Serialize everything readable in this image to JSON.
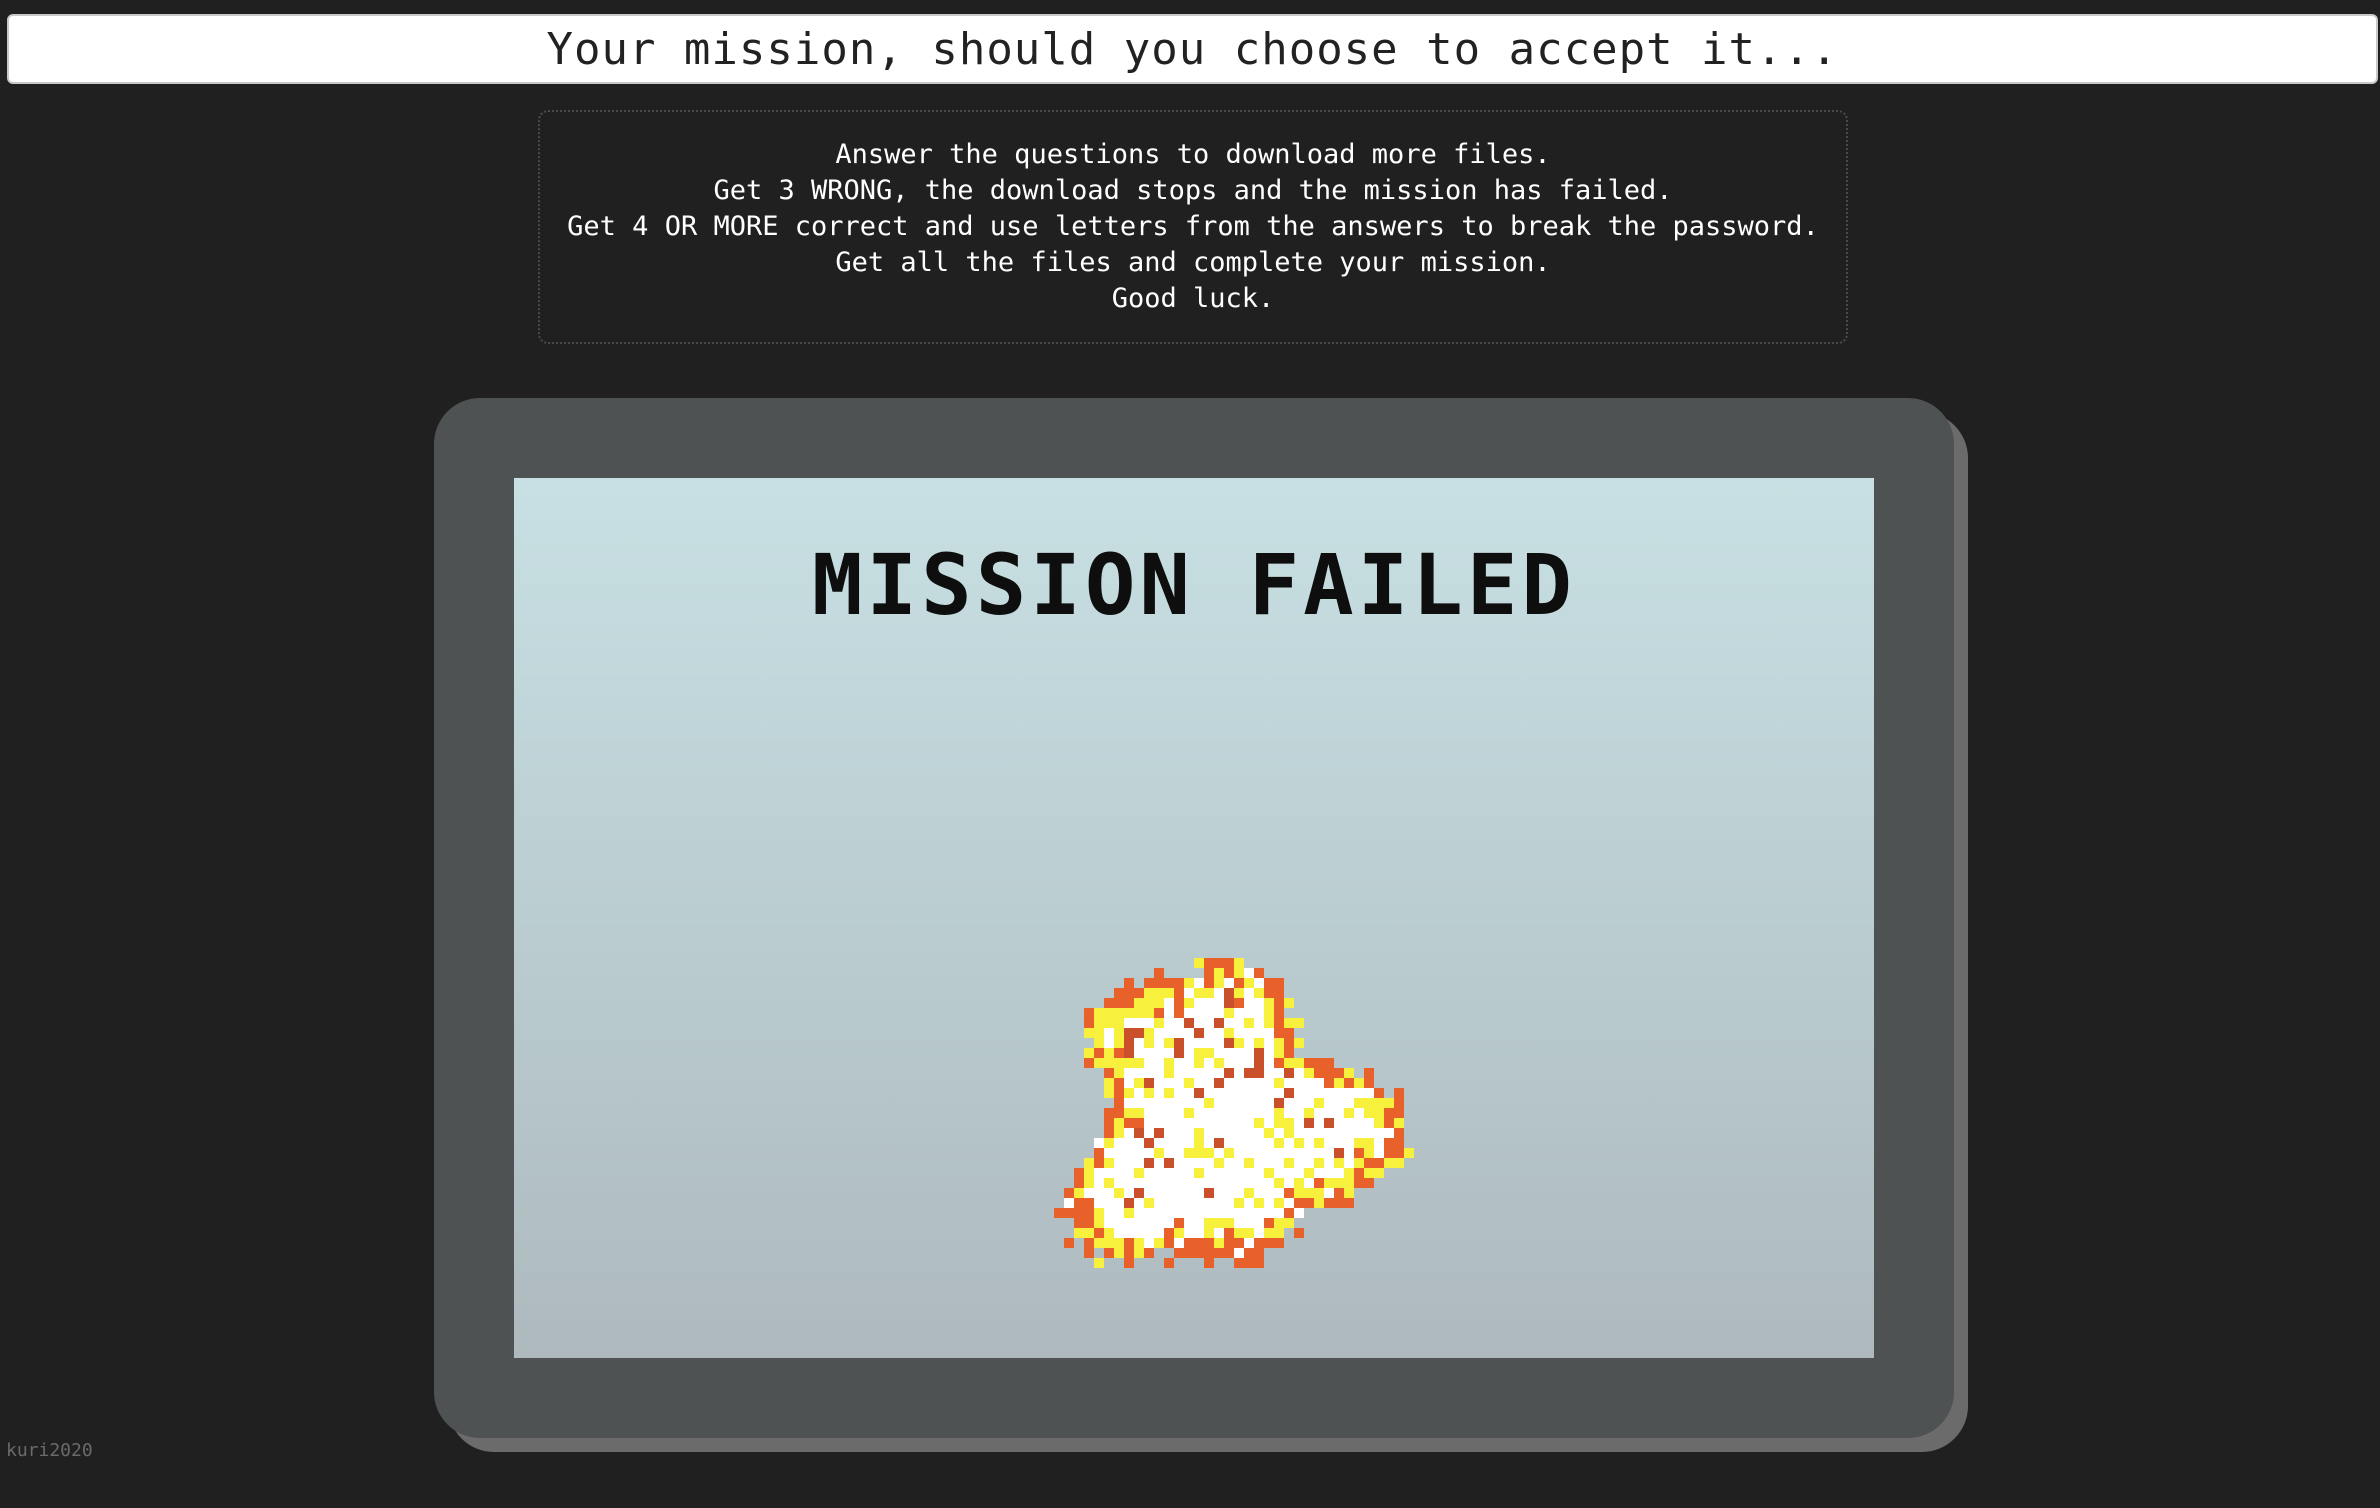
{
  "header": {
    "title": "Your mission, should you choose to accept it..."
  },
  "instructions": {
    "lines": [
      "Answer the questions to download more files.",
      "Get 3 WRONG, the download stops and the mission has failed.",
      "Get 4 OR MORE correct and use letters from the answers to break the password.",
      "Get all the files and complete your mission.",
      "Good luck."
    ]
  },
  "screen": {
    "status_text": "MISSION FAILED",
    "graphic": "pixel-explosion"
  },
  "footer": {
    "credit": "kuri2020"
  },
  "colors": {
    "background": "#202020",
    "monitor_frame": "#4e5253",
    "screen_top": "#c8e0e3",
    "screen_bottom": "#aeb9be",
    "explosion_outer": "#e8612a",
    "explosion_mid": "#f7f03d",
    "explosion_core": "#ffffff",
    "explosion_spark": "#c9502a"
  }
}
